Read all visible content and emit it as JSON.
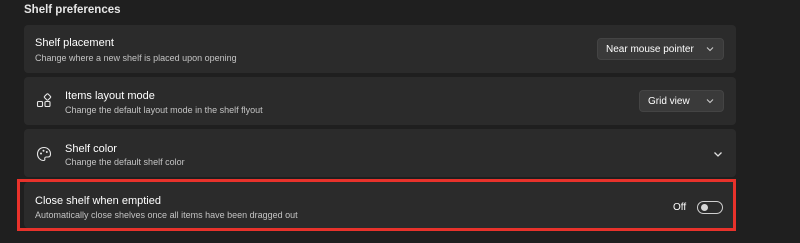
{
  "section": {
    "title": "Shelf preferences"
  },
  "settings": [
    {
      "title": "Shelf placement",
      "description": "Change where a new shelf is placed upon opening",
      "control": "dropdown",
      "value": "Near mouse pointer"
    },
    {
      "title": "Items layout mode",
      "description": "Change the default layout mode in the shelf flyout",
      "icon": "grid-layout-icon",
      "control": "dropdown",
      "value": "Grid view"
    },
    {
      "title": "Shelf color",
      "description": "Change the default shelf color",
      "icon": "palette-icon",
      "control": "expander"
    },
    {
      "title": "Close shelf when emptied",
      "description": "Automatically close shelves once all items have been dragged out",
      "control": "toggle",
      "value": "Off",
      "toggle_on": false
    }
  ],
  "colors": {
    "background": "#1f1f1f",
    "card": "#2b2b2b",
    "highlight": "#e8322b"
  }
}
